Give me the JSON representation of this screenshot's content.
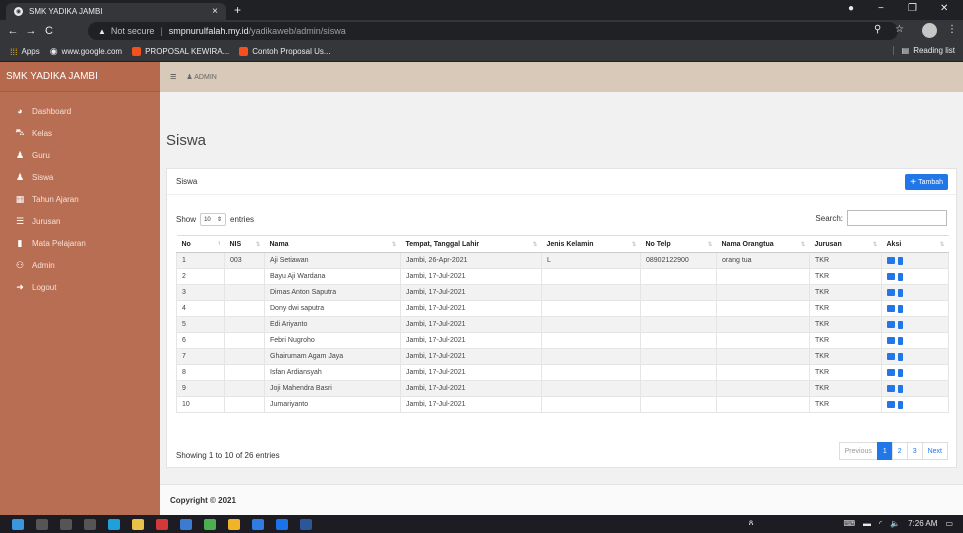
{
  "browser": {
    "tab_title": "SMK YADIKA JAMBI",
    "tab_close": "×",
    "new_tab": "+",
    "address": {
      "warning": "▲",
      "security": "Not secure",
      "host": "smpnurulfalah.my.id",
      "path": "/yadikaweb/admin/siswa"
    },
    "bookmarks": [
      {
        "label": "Apps"
      },
      {
        "label": "www.google.com"
      },
      {
        "label": "PROPOSAL KEWIRA..."
      },
      {
        "label": "Contoh Proposal Us..."
      }
    ],
    "reading_list": "Reading list"
  },
  "sidebar": {
    "brand": "SMK YADIKA JAMBI",
    "items": [
      {
        "label": "Dashboard",
        "icon": "dashboard-icon"
      },
      {
        "label": "Kelas",
        "icon": "car-icon"
      },
      {
        "label": "Guru",
        "icon": "user-icon"
      },
      {
        "label": "Siswa",
        "icon": "user-icon"
      },
      {
        "label": "Tahun Ajaran",
        "icon": "calendar-icon"
      },
      {
        "label": "Jurusan",
        "icon": "list-icon"
      },
      {
        "label": "Mata Pelajaran",
        "icon": "book-icon"
      },
      {
        "label": "Admin",
        "icon": "users-icon"
      },
      {
        "label": "Logout",
        "icon": "logout-icon"
      }
    ]
  },
  "topbar": {
    "user": "ADMIN"
  },
  "page": {
    "title": "Siswa",
    "card_title": "Siswa",
    "add_button": "Tambah",
    "show_label": "Show",
    "entries_value": "10",
    "entries_label": "entries",
    "search_label": "Search:",
    "columns": [
      "No",
      "NIS",
      "Nama",
      "Tempat, Tanggal Lahir",
      "Jenis Kelamin",
      "No Telp",
      "Nama Orangtua",
      "Jurusan",
      "Aksi"
    ],
    "rows": [
      [
        "1",
        "003",
        "Aji Setiawan",
        "Jambi, 26-Apr-2021",
        "L",
        "08902122900",
        "orang tua",
        "TKR"
      ],
      [
        "2",
        "",
        "Bayu Aji Wardana",
        "Jambi, 17-Jul-2021",
        "",
        "",
        "",
        "TKR"
      ],
      [
        "3",
        "",
        "Dimas Anton Saputra",
        "Jambi, 17-Jul-2021",
        "",
        "",
        "",
        "TKR"
      ],
      [
        "4",
        "",
        "Dony dwi saputra",
        "Jambi, 17-Jul-2021",
        "",
        "",
        "",
        "TKR"
      ],
      [
        "5",
        "",
        "Edi Ariyanto",
        "Jambi, 17-Jul-2021",
        "",
        "",
        "",
        "TKR"
      ],
      [
        "6",
        "",
        "Febri Nugroho",
        "Jambi, 17-Jul-2021",
        "",
        "",
        "",
        "TKR"
      ],
      [
        "7",
        "",
        "Ghairumam Agam Jaya",
        "Jambi, 17-Jul-2021",
        "",
        "",
        "",
        "TKR"
      ],
      [
        "8",
        "",
        "Isfan Ardiansyah",
        "Jambi, 17-Jul-2021",
        "",
        "",
        "",
        "TKR"
      ],
      [
        "9",
        "",
        "Joji Mahendra Basri",
        "Jambi, 17-Jul-2021",
        "",
        "",
        "",
        "TKR"
      ],
      [
        "10",
        "",
        "Jumariyanto",
        "Jambi, 17-Jul-2021",
        "",
        "",
        "",
        "TKR"
      ]
    ],
    "info": "Showing 1 to 10 of 26 entries",
    "pagination": {
      "previous": "Previous",
      "pages": [
        "1",
        "2",
        "3"
      ],
      "next": "Next",
      "active": "1"
    },
    "footer": "Copyright © 2021"
  },
  "taskbar": {
    "time": "7:26 AM"
  },
  "colors": {
    "sidebar": "#b86e53",
    "topbar": "#d9c9b8",
    "primary": "#2176e8"
  }
}
